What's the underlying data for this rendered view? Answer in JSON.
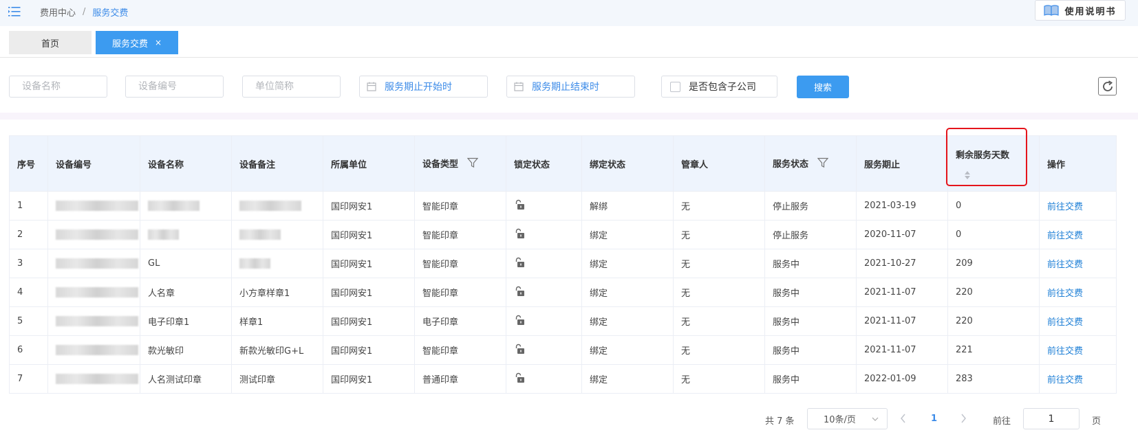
{
  "breadcrumb": {
    "root": "费用中心",
    "separator": "/",
    "current": "服务交费"
  },
  "header": {
    "manual_label": "使用说明书"
  },
  "tabs": [
    {
      "label": "首页"
    },
    {
      "label": "服务交费",
      "close": "×"
    }
  ],
  "filters": {
    "device_name_placeholder": "设备名称",
    "device_code_placeholder": "设备编号",
    "unit_abbr_placeholder": "单位简称",
    "service_start": "服务期止开始时",
    "service_end": "服务期止结束时",
    "include_sub": "是否包含子公司",
    "search_label": "搜索"
  },
  "table": {
    "headers": {
      "index": "序号",
      "device_code": "设备编号",
      "device_name": "设备名称",
      "device_note": "设备备注",
      "unit": "所属单位",
      "device_type": "设备类型",
      "lock_status": "锁定状态",
      "bind_status": "绑定状态",
      "keeper": "管章人",
      "service_status": "服务状态",
      "service_end": "服务期止",
      "remaining_days": "剩余服务天数",
      "action": "操作"
    },
    "rows": [
      {
        "index": "1",
        "device_name": "",
        "device_note": "",
        "unit": "国印网安1",
        "device_type": "智能印章",
        "bind_status": "解绑",
        "keeper": "无",
        "service_status": "停止服务",
        "service_end": "2021-03-19",
        "remaining_days": "0",
        "action": "前往交费"
      },
      {
        "index": "2",
        "device_name": "",
        "device_note": "",
        "unit": "国印网安1",
        "device_type": "智能印章",
        "bind_status": "绑定",
        "keeper": "无",
        "service_status": "停止服务",
        "service_end": "2020-11-07",
        "remaining_days": "0",
        "action": "前往交费"
      },
      {
        "index": "3",
        "device_name": "GL",
        "device_note": "",
        "unit": "国印网安1",
        "device_type": "智能印章",
        "bind_status": "绑定",
        "keeper": "无",
        "service_status": "服务中",
        "service_end": "2021-10-27",
        "remaining_days": "209",
        "action": "前往交费"
      },
      {
        "index": "4",
        "device_name": "人名章",
        "device_note": "小方章样章1",
        "unit": "国印网安1",
        "device_type": "智能印章",
        "bind_status": "绑定",
        "keeper": "无",
        "service_status": "服务中",
        "service_end": "2021-11-07",
        "remaining_days": "220",
        "action": "前往交费"
      },
      {
        "index": "5",
        "device_name": "电子印章1",
        "device_note": "样章1",
        "unit": "国印网安1",
        "device_type": "电子印章",
        "bind_status": "绑定",
        "keeper": "无",
        "service_status": "服务中",
        "service_end": "2021-11-07",
        "remaining_days": "220",
        "action": "前往交费"
      },
      {
        "index": "6",
        "device_name": "款光敏印",
        "device_note": "新款光敏印G+L",
        "unit": "国印网安1",
        "device_type": "智能印章",
        "bind_status": "绑定",
        "keeper": "无",
        "service_status": "服务中",
        "service_end": "2021-11-07",
        "remaining_days": "221",
        "action": "前往交费"
      },
      {
        "index": "7",
        "device_name": "人名测试印章",
        "device_note": "测试印章",
        "unit": "国印网安1",
        "device_type": "普通印章",
        "bind_status": "绑定",
        "keeper": "无",
        "service_status": "服务中",
        "service_end": "2022-01-09",
        "remaining_days": "283",
        "action": "前往交费"
      }
    ]
  },
  "pagination": {
    "total": "共 7 条",
    "page_size": "10条/页",
    "current_page": "1",
    "goto_label": "前往",
    "goto_value": "1",
    "page_suffix": "页"
  },
  "colors": {
    "accent": "#3c9bf0",
    "link": "#1e7fd6",
    "highlight": "#e5141b"
  }
}
